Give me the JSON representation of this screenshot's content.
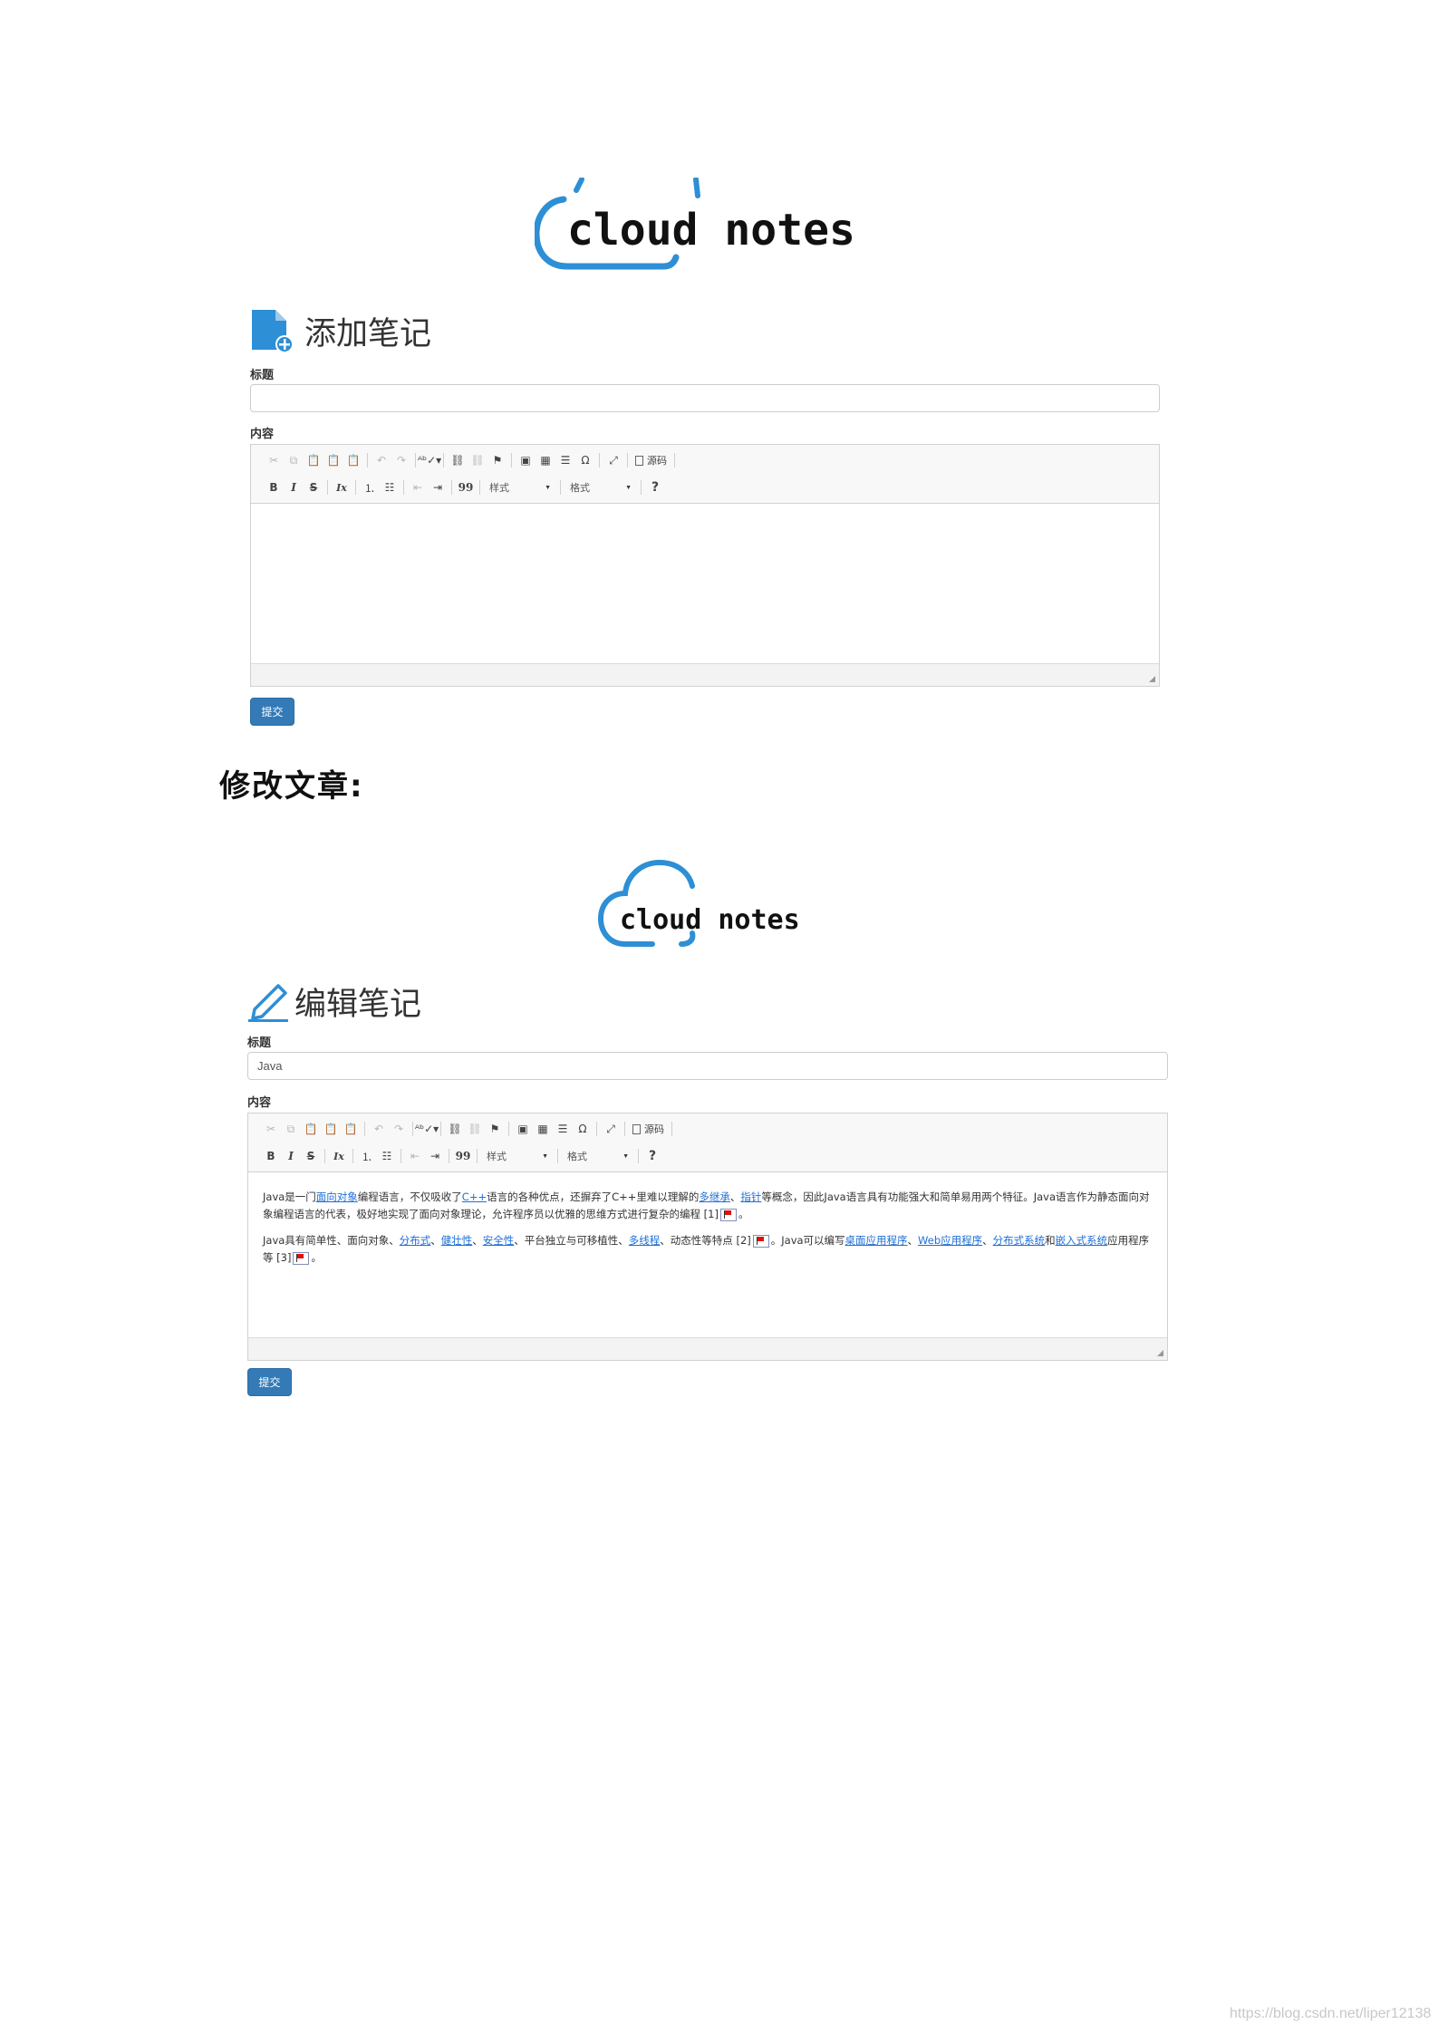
{
  "add_note": {
    "logo_text": "cloud notes",
    "page_title": "添加笔记",
    "title_label": "标题",
    "title_value": "",
    "content_label": "内容",
    "content_paragraphs": [],
    "submit_label": "提交"
  },
  "section_heading": "修改文章:",
  "edit_note": {
    "logo_text": "cloud notes",
    "page_title": "编辑笔记",
    "title_label": "标题",
    "title_value": "Java",
    "content_label": "内容",
    "submit_label": "提交",
    "content": {
      "p1_a": "Java是一门",
      "p1_link1": "面向对象",
      "p1_b": "编程语言，不仅吸收了",
      "p1_link2": "C++",
      "p1_c": "语言的各种优点，还摒弃了C++里难以理解的",
      "p1_link3": "多继承",
      "p1_d": "、",
      "p1_link4": "指针",
      "p1_e": "等概念，因此Java语言具有功能强大和简单易用两个特征。Java语言作为静态面向对象编程语言的代表，极好地实现了面向对象理论，允许程序员以优雅的思维方式进行复杂的编程 ",
      "p1_ref": "[1]",
      "p1_end": "。",
      "p2_a": "Java具有简单性、面向对象、",
      "p2_link1": "分布式",
      "p2_b": "、",
      "p2_link2": "健壮性",
      "p2_c": "、",
      "p2_link3": "安全性",
      "p2_d": "、平台独立与可移植性、",
      "p2_link4": "多线程",
      "p2_e": "、动态性等特点 ",
      "p2_ref": "[2]",
      "p2_f": "。Java可以编写",
      "p2_link5": "桌面应用程序",
      "p2_g": "、",
      "p2_link6": "Web应用程序",
      "p2_h": "、",
      "p2_link7": "分布式系统",
      "p2_i": "和",
      "p2_link8": "嵌入式系统",
      "p2_j": "应用程序等 ",
      "p2_ref2": "[3]",
      "p2_end": "。"
    }
  },
  "toolbar": {
    "source_label": "源码",
    "styles_combo": "样式",
    "format_combo": "格式",
    "help_label": "?",
    "bold_label": "B",
    "italic_label": "I",
    "strike_label": "S",
    "remove_format_label": "Ix",
    "quote_label": "99",
    "omega_label": "Ω"
  },
  "watermark": "https://blog.csdn.net/liper12138",
  "colors": {
    "brand_blue": "#2d8fd5",
    "button_blue": "#337ab7",
    "link_blue": "#1e6fd6",
    "flag_red": "#dd1111"
  },
  "icons": {
    "add_note_icon": "document-plus-icon",
    "edit_note_icon": "pencil-icon",
    "logo_icon": "cloud-icon"
  }
}
